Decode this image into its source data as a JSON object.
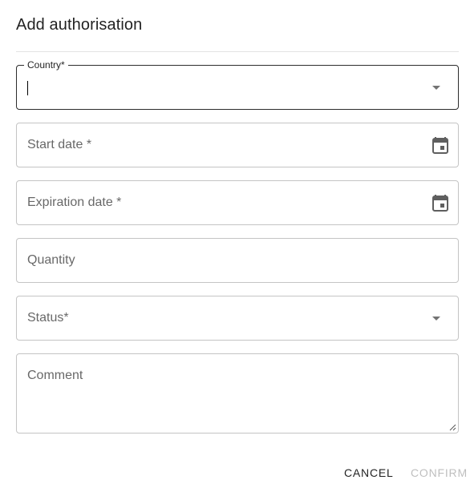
{
  "dialog": {
    "title": "Add authorisation"
  },
  "fields": {
    "country": {
      "label": "Country*",
      "value": ""
    },
    "start_date": {
      "label": "Start date *",
      "icon": "calendar-icon"
    },
    "expiration_date": {
      "label": "Expiration date *",
      "icon": "calendar-icon"
    },
    "quantity": {
      "label": "Quantity"
    },
    "status": {
      "label": "Status*"
    },
    "comment": {
      "label": "Comment"
    }
  },
  "actions": {
    "cancel_label": "CANCEL",
    "confirm_label": "CONFIRM"
  },
  "colors": {
    "border": "#c4c4c4",
    "focused_border": "#2c2c2c",
    "disabled_text": "#bdbdbd"
  }
}
